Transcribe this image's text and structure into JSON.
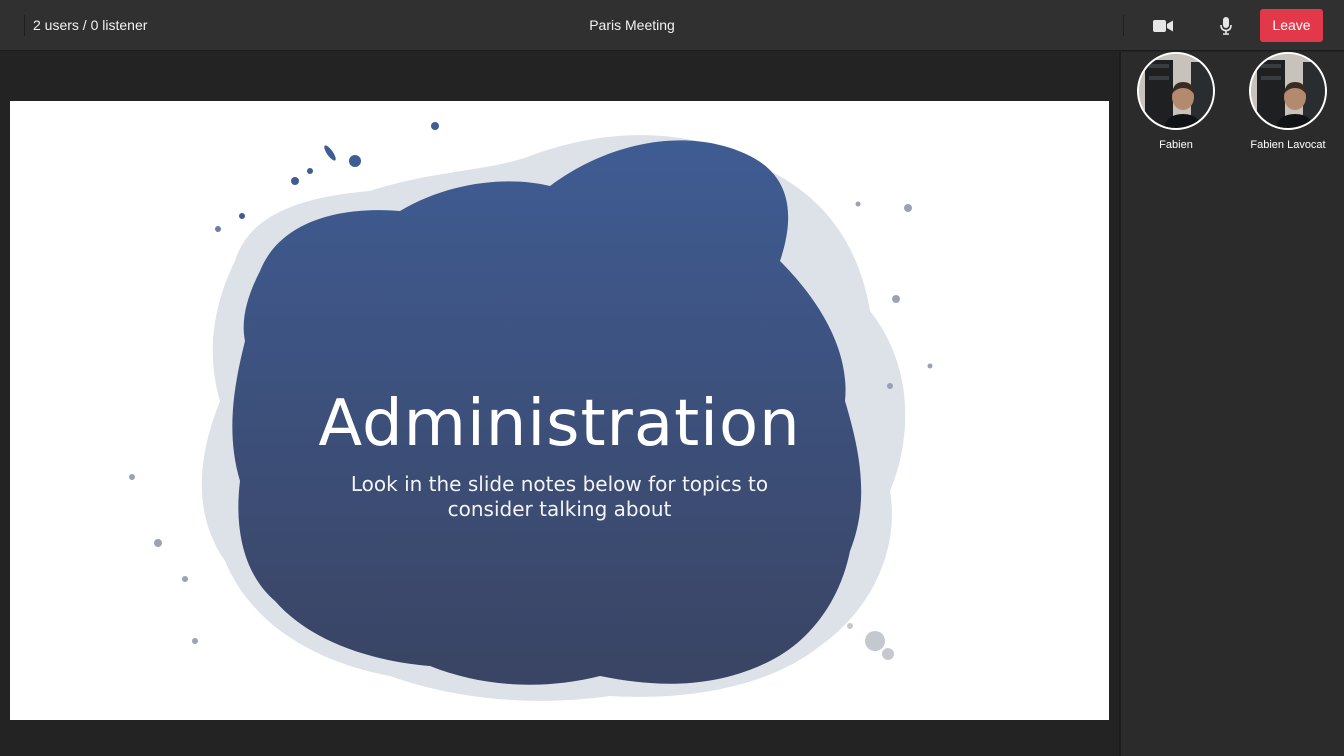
{
  "header": {
    "user_count": "2 users / 0 listener",
    "meeting_title": "Paris Meeting",
    "camera_icon": "video-camera-icon",
    "mic_icon": "microphone-icon",
    "leave_label": "Leave"
  },
  "slide": {
    "title": "Administration",
    "subtitle": "Look in the slide notes below for topics to consider talking about",
    "blot_color_top": "#3f5c93",
    "blot_color_bottom": "#3a4463"
  },
  "participants": [
    {
      "name": "Fabien"
    },
    {
      "name": "Fabien Lavocat"
    }
  ],
  "colors": {
    "leave": "#e3384a",
    "topbar": "#303030",
    "background": "#232323"
  }
}
